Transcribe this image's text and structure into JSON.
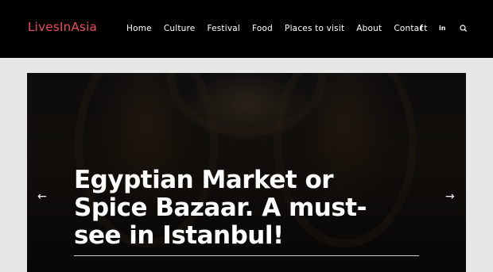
{
  "site": {
    "logo": "LivesInAsia"
  },
  "nav": {
    "items": [
      {
        "label": "Home"
      },
      {
        "label": "Culture"
      },
      {
        "label": "Festival"
      },
      {
        "label": "Food"
      },
      {
        "label": "Places to visit"
      },
      {
        "label": "About"
      },
      {
        "label": "Contact"
      }
    ]
  },
  "social": {
    "facebook": "f",
    "linkedin": "in"
  },
  "icons": [
    "facebook-icon",
    "linkedin-icon",
    "search-icon",
    "arrow-left-icon",
    "arrow-right-icon"
  ],
  "slider": {
    "title": "Egyptian Market or Spice Bazaar. A must-see in Istanbul!",
    "prev": "←",
    "next": "→"
  },
  "colors": {
    "header_bg": "#000000",
    "logo": "#f04a5c",
    "page_bg": "#e7e7e7"
  }
}
